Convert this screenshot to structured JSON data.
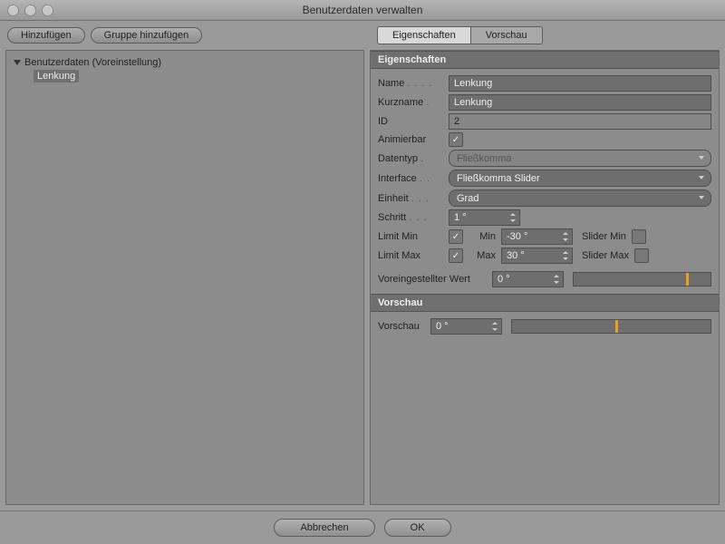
{
  "window": {
    "title": "Benutzerdaten verwalten"
  },
  "toolbar": {
    "add": "Hinzufügen",
    "addGroup": "Gruppe hinzufügen"
  },
  "tabs": {
    "props": "Eigenschaften",
    "preview": "Vorschau"
  },
  "tree": {
    "root": "Benutzerdaten (Voreinstellung)",
    "child": "Lenkung"
  },
  "sections": {
    "props": "Eigenschaften",
    "preview": "Vorschau"
  },
  "labels": {
    "name": "Name",
    "short": "Kurzname",
    "id": "ID",
    "anim": "Animierbar",
    "dtype": "Datentyp",
    "iface": "Interface",
    "unit": "Einheit",
    "step": "Schritt",
    "limmin": "Limit Min",
    "limmax": "Limit Max",
    "min": "Min",
    "max": "Max",
    "smin": "Slider Min",
    "smax": "Slider Max",
    "preset": "Voreingestellter Wert",
    "prev": "Vorschau"
  },
  "values": {
    "name": "Lenkung",
    "short": "Lenkung",
    "id": "2",
    "dtype": "Fließkomma",
    "iface": "Fließkomma Slider",
    "unit": "Grad",
    "step": "1 °",
    "min": "-30 °",
    "max": "30 °",
    "preset": "0 °",
    "prev": "0 °"
  },
  "sliders": {
    "presetPos": 82,
    "prevPos": 52
  },
  "footer": {
    "cancel": "Abbrechen",
    "ok": "OK"
  }
}
